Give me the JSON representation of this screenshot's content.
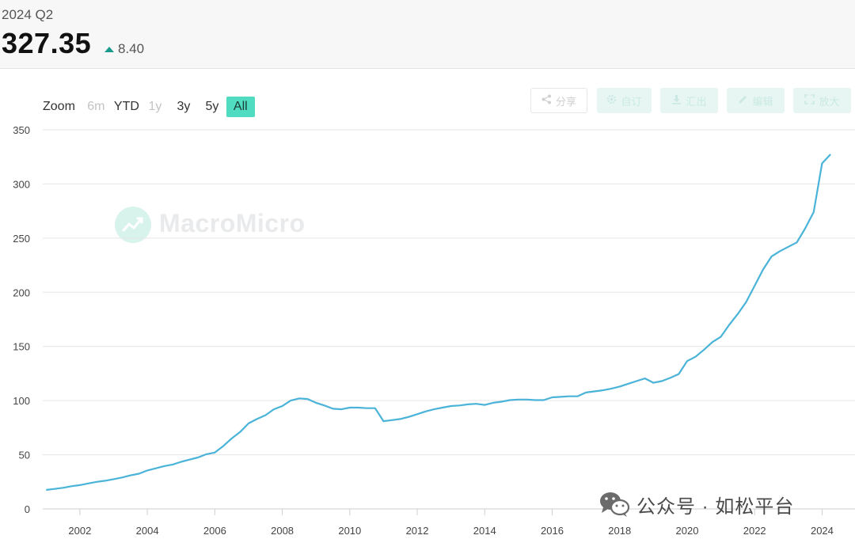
{
  "header": {
    "period": "2024 Q2",
    "value": "327.35",
    "change": "8.40",
    "change_direction": "up",
    "up_color": "#1a9a8a"
  },
  "zoom": {
    "label": "Zoom",
    "buttons": [
      {
        "label": "6m",
        "state": "disabled"
      },
      {
        "label": "YTD",
        "state": "normal"
      },
      {
        "label": "1y",
        "state": "disabled"
      },
      {
        "label": "3y",
        "state": "normal"
      },
      {
        "label": "5y",
        "state": "normal"
      },
      {
        "label": "All",
        "state": "active"
      }
    ],
    "active_color": "#4fdcc0"
  },
  "toolbar": {
    "buttons": [
      {
        "label": "分享",
        "icon": "share-icon"
      },
      {
        "label": "自订",
        "icon": "gear-icon"
      },
      {
        "label": "汇出",
        "icon": "download-icon"
      },
      {
        "label": "编辑",
        "icon": "pencil-icon"
      },
      {
        "label": "放大",
        "icon": "expand-icon"
      }
    ]
  },
  "watermark": {
    "text": "MacroMicro",
    "icon": "macromicro-logo-icon"
  },
  "wechat": {
    "text": "公众号 · 如松平台",
    "icon": "wechat-icon"
  },
  "chart_data": {
    "type": "line",
    "title": "",
    "xlabel": "",
    "ylabel": "",
    "line_color": "#4ab3d8",
    "grid": "horizontal",
    "legend": "none",
    "xlim": [
      2000.9,
      2024.6
    ],
    "ylim": [
      0,
      350
    ],
    "yticks": [
      0,
      50,
      100,
      150,
      200,
      250,
      300,
      350
    ],
    "xticks": [
      2002,
      2004,
      2006,
      2008,
      2010,
      2012,
      2014,
      2016,
      2018,
      2020,
      2022,
      2024
    ],
    "series": [
      {
        "x": [
          2001.0,
          2001.25,
          2001.5,
          2001.75,
          2002.0,
          2002.25,
          2002.5,
          2002.75,
          2003.0,
          2003.25,
          2003.5,
          2003.75,
          2004.0,
          2004.25,
          2004.5,
          2004.75,
          2005.0,
          2005.25,
          2005.5,
          2005.75,
          2006.0,
          2006.25,
          2006.5,
          2006.75,
          2007.0,
          2007.25,
          2007.5,
          2007.75,
          2008.0,
          2008.25,
          2008.5,
          2008.75,
          2009.0,
          2009.25,
          2009.5,
          2009.75,
          2010.0,
          2010.25,
          2010.5,
          2010.75,
          2011.0,
          2011.25,
          2011.5,
          2011.75,
          2012.0,
          2012.25,
          2012.5,
          2012.75,
          2013.0,
          2013.25,
          2013.5,
          2013.75,
          2014.0,
          2014.25,
          2014.5,
          2014.75,
          2015.0,
          2015.25,
          2015.5,
          2015.75,
          2016.0,
          2016.25,
          2016.5,
          2016.75,
          2017.0,
          2017.25,
          2017.5,
          2017.75,
          2018.0,
          2018.25,
          2018.5,
          2018.75,
          2019.0,
          2019.25,
          2019.5,
          2019.75,
          2020.0,
          2020.25,
          2020.5,
          2020.75,
          2021.0,
          2021.25,
          2021.5,
          2021.75,
          2022.0,
          2022.25,
          2022.5,
          2022.75,
          2023.0,
          2023.25,
          2023.5,
          2023.75,
          2024.0,
          2024.25
        ],
        "y": [
          17.5,
          18.5,
          19.5,
          21,
          22,
          23.5,
          25,
          26,
          27.5,
          29,
          31,
          32.5,
          35.5,
          37.5,
          39.5,
          41,
          43.5,
          45.5,
          47.5,
          50.5,
          52,
          58,
          65,
          71,
          79,
          83,
          86.5,
          92,
          95,
          100,
          102,
          101.5,
          98,
          95.5,
          92.5,
          92,
          93.5,
          93.5,
          93,
          93,
          81,
          82,
          83,
          85,
          87.5,
          90,
          92,
          93.5,
          95,
          95.5,
          96.5,
          97,
          96,
          98,
          99,
          100.5,
          101,
          101,
          100.5,
          100.5,
          103,
          103.5,
          104,
          104,
          107.5,
          108.5,
          109.5,
          111,
          113,
          115.5,
          118,
          120.5,
          116.5,
          118,
          121,
          124.5,
          136.5,
          140.5,
          147,
          154,
          159,
          170,
          180,
          191,
          206,
          221,
          233,
          238,
          242,
          246,
          259,
          274,
          319,
          327.35
        ]
      }
    ]
  }
}
